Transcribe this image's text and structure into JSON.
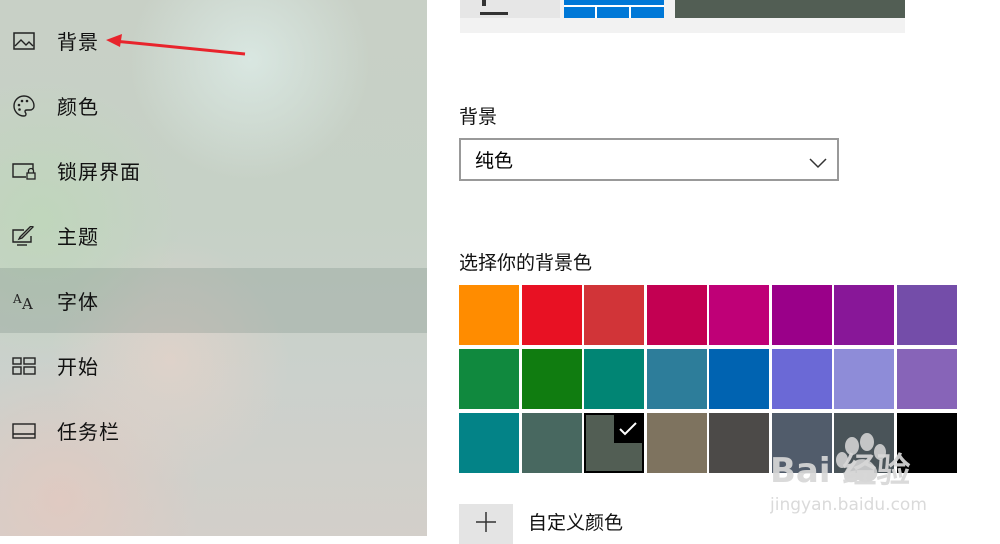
{
  "sidebar": {
    "items": [
      {
        "label": "背景",
        "icon": "picture-icon"
      },
      {
        "label": "颜色",
        "icon": "palette-icon"
      },
      {
        "label": "锁屏界面",
        "icon": "lock-screen-icon"
      },
      {
        "label": "主题",
        "icon": "theme-brush-icon"
      },
      {
        "label": "字体",
        "icon": "font-icon"
      },
      {
        "label": "开始",
        "icon": "start-grid-icon"
      },
      {
        "label": "任务栏",
        "icon": "taskbar-icon"
      }
    ],
    "selected_index": 4
  },
  "main": {
    "background_label": "背景",
    "background_select_value": "纯色",
    "choose_color_label": "选择你的背景色",
    "custom_color_label": "自定义颜色",
    "swatches": [
      "#ff8c00",
      "#e81123",
      "#d13438",
      "#c30052",
      "#bf0077",
      "#9a0089",
      "#881798",
      "#744da9",
      "#10893e",
      "#107c10",
      "#018574",
      "#2d7d9a",
      "#0063b1",
      "#6b69d6",
      "#8e8cd8",
      "#8764b8",
      "#038387",
      "#486860",
      "#525e54",
      "#7e735f",
      "#4c4a48",
      "#515c6b",
      "#4a5459",
      "#000000"
    ],
    "selected_swatch": 18
  },
  "annotation": {
    "arrow_color": "#e8242c"
  },
  "watermark": {
    "brand": "Bai 经验",
    "url": "jingyan.baidu.com"
  }
}
